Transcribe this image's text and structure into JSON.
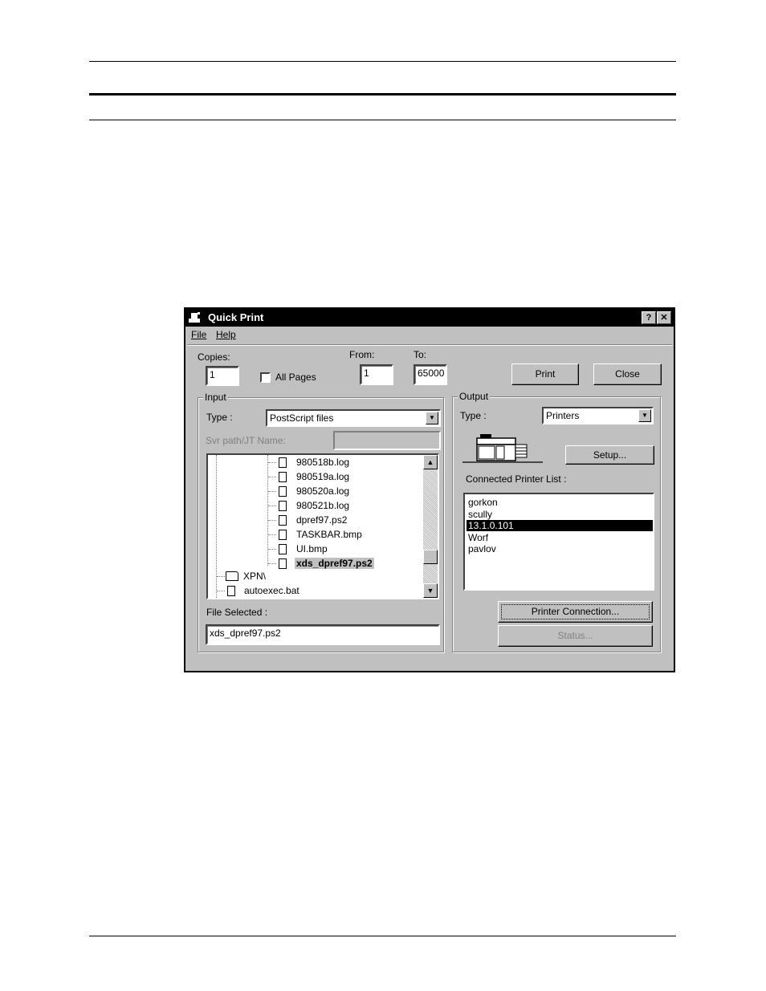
{
  "dialog": {
    "title": "Quick Print",
    "help_btn": "?",
    "close_btn": "✕",
    "menu": {
      "file": "File",
      "help": "Help"
    }
  },
  "copies": {
    "label": "Copies:",
    "value": "1",
    "all_pages_label": "All Pages",
    "all_pages_checked": false
  },
  "range": {
    "from_label": "From:",
    "from_value": "1",
    "to_label": "To:",
    "to_value": "65000"
  },
  "buttons": {
    "print": "Print",
    "close": "Close",
    "setup": "Setup...",
    "printer_connection": "Printer Connection...",
    "status": "Status..."
  },
  "input": {
    "group_label": "Input",
    "type_label": "Type :",
    "type_value": "PostScript files",
    "svr_label": "Svr path/JT Name:",
    "svr_value": "",
    "files": [
      "980518b.log",
      "980519a.log",
      "980520a.log",
      "980521b.log",
      "dpref97.ps2",
      "TASKBAR.bmp",
      "UI.bmp",
      "xds_dpref97.ps2"
    ],
    "selected_file_index": 7,
    "folders": [
      "XPN\\",
      "autoexec.bat"
    ],
    "file_selected_label": "File Selected :",
    "file_selected_value": "xds_dpref97.ps2"
  },
  "output": {
    "group_label": "Output",
    "type_label": "Type :",
    "type_value": "Printers",
    "printer_list_label": "Connected Printer List :",
    "printers": [
      "gorkon",
      "scully",
      "13.1.0.101",
      "Worf",
      "pavlov"
    ],
    "selected_printer_index": 2
  },
  "colors": {
    "titlebar": "#000000",
    "face": "#c0c0c0",
    "selection": "#000000"
  }
}
